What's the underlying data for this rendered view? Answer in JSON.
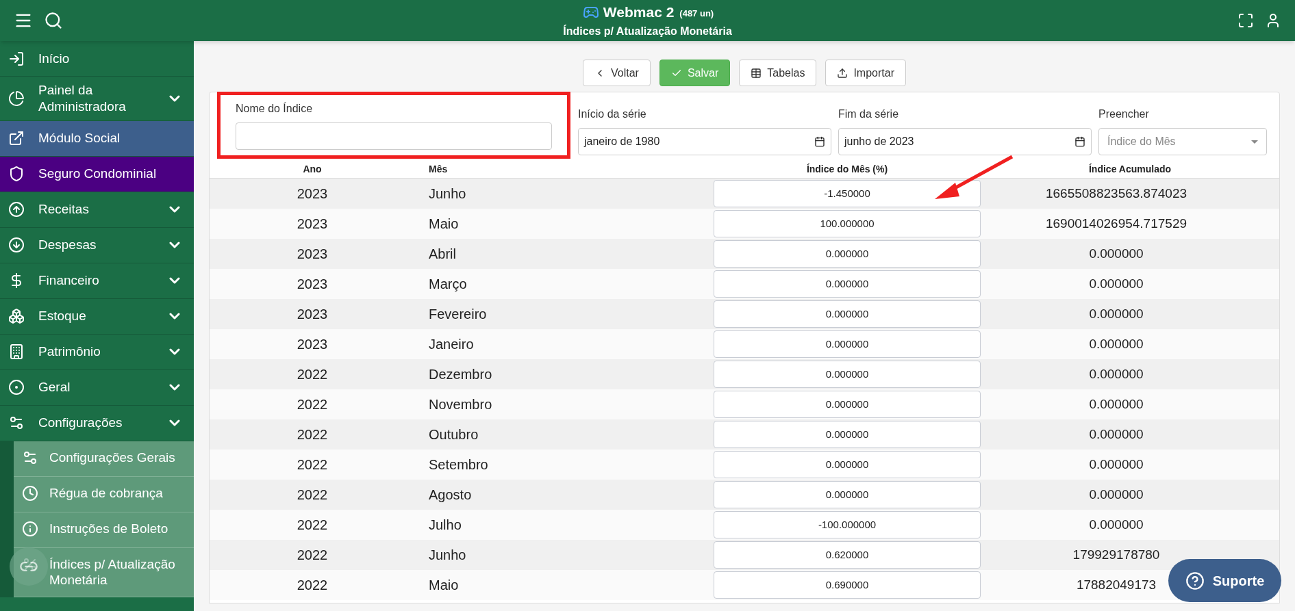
{
  "header": {
    "title": "Webmac 2",
    "count": "(487 un)",
    "subtitle": "Índices p/ Atualização Monetária"
  },
  "sidebar": {
    "items": [
      {
        "label": "Início",
        "kind": "link"
      },
      {
        "label": "Painel da Administradora",
        "kind": "menu"
      },
      {
        "label": "Módulo Social",
        "kind": "link",
        "color": "#3d5f8c"
      },
      {
        "label": "Seguro Condominial",
        "kind": "link",
        "color": "#4b0082"
      },
      {
        "label": "Receitas",
        "kind": "menu"
      },
      {
        "label": "Despesas",
        "kind": "menu"
      },
      {
        "label": "Financeiro",
        "kind": "menu"
      },
      {
        "label": "Estoque",
        "kind": "menu"
      },
      {
        "label": "Patrimônio",
        "kind": "menu"
      },
      {
        "label": "Geral",
        "kind": "menu"
      },
      {
        "label": "Configurações",
        "kind": "menu",
        "children": [
          {
            "label": "Configurações Gerais"
          },
          {
            "label": "Régua de cobrança"
          },
          {
            "label": "Instruções de Boleto"
          },
          {
            "label": "Índices p/ Atualização Monetária"
          }
        ]
      }
    ]
  },
  "toolbar": [
    {
      "label": "Voltar",
      "kind": "default"
    },
    {
      "label": "Salvar",
      "kind": "primary"
    },
    {
      "label": "Tabelas",
      "kind": "default"
    },
    {
      "label": "Importar",
      "kind": "default"
    }
  ],
  "fields": [
    {
      "label": "Nome do Índice",
      "kind": "text",
      "highlighted": true
    },
    {
      "label": "Início da série",
      "kind": "date",
      "value": "janeiro de 1980",
      "highlighted": false
    },
    {
      "label": "Fim da série",
      "kind": "date",
      "value": "junho de 2023",
      "highlighted": false
    },
    {
      "label": "Preencher",
      "kind": "select",
      "placeholder": "Índice do Mês",
      "highlighted": false
    }
  ],
  "table": {
    "columns": [
      "Ano",
      "Mês",
      "Índice do Mês (%)",
      "Índice Acumulado"
    ],
    "rows": [
      {
        "year": "2023",
        "month": "Junho",
        "index": "-1.450000",
        "accumulated": "1665508823563.874023"
      },
      {
        "year": "2023",
        "month": "Maio",
        "index": "100.000000",
        "accumulated": "1690014026954.717529"
      },
      {
        "year": "2023",
        "month": "Abril",
        "index": "0.000000",
        "accumulated": "0.000000"
      },
      {
        "year": "2023",
        "month": "Março",
        "index": "0.000000",
        "accumulated": "0.000000"
      },
      {
        "year": "2023",
        "month": "Fevereiro",
        "index": "0.000000",
        "accumulated": "0.000000"
      },
      {
        "year": "2023",
        "month": "Janeiro",
        "index": "0.000000",
        "accumulated": "0.000000"
      },
      {
        "year": "2022",
        "month": "Dezembro",
        "index": "0.000000",
        "accumulated": "0.000000"
      },
      {
        "year": "2022",
        "month": "Novembro",
        "index": "0.000000",
        "accumulated": "0.000000"
      },
      {
        "year": "2022",
        "month": "Outubro",
        "index": "0.000000",
        "accumulated": "0.000000"
      },
      {
        "year": "2022",
        "month": "Setembro",
        "index": "0.000000",
        "accumulated": "0.000000"
      },
      {
        "year": "2022",
        "month": "Agosto",
        "index": "0.000000",
        "accumulated": "0.000000"
      },
      {
        "year": "2022",
        "month": "Julho",
        "index": "-100.000000",
        "accumulated": "0.000000"
      },
      {
        "year": "2022",
        "month": "Junho",
        "index": "0.620000",
        "accumulated": "179929178780"
      },
      {
        "year": "2022",
        "month": "Maio",
        "index": "0.690000",
        "accumulated": "17882049173"
      }
    ]
  },
  "support_button": {
    "label": "Suporte"
  }
}
